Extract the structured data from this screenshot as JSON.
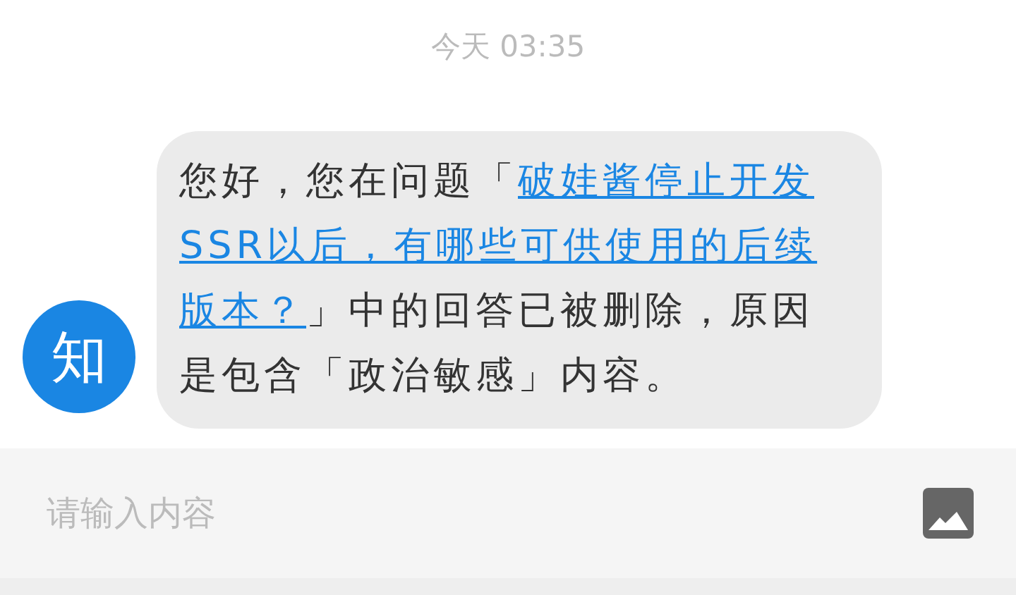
{
  "timestamp": "今天 03:35",
  "message": {
    "avatar": "知",
    "lines": [
      [
        {
          "kind": "text",
          "text": "您好，您在问题「"
        },
        {
          "kind": "link",
          "text": "破娃酱停止开发"
        }
      ],
      [
        {
          "kind": "link",
          "text": "SSR以后，有哪些可供使用的后续"
        }
      ],
      [
        {
          "kind": "link",
          "text": "版本？"
        },
        {
          "kind": "text",
          "text": "」中的回答已被删除，原因"
        }
      ],
      [
        {
          "kind": "text",
          "text": "是包含「政治敏感」内容。"
        }
      ]
    ]
  },
  "composer": {
    "placeholder": "请输入内容"
  }
}
